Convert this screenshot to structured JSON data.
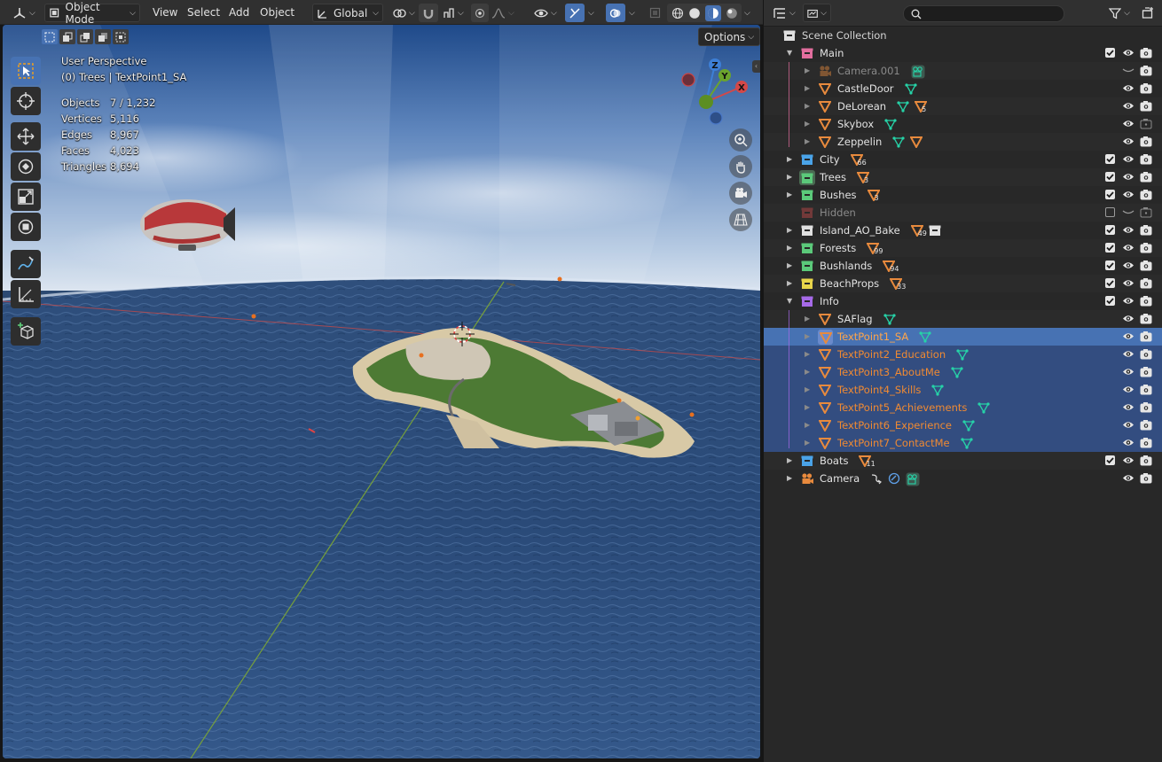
{
  "header": {
    "mode_label": "Object Mode",
    "menu_view": "View",
    "menu_select": "Select",
    "menu_add": "Add",
    "menu_object": "Object",
    "orientation_label": "Global",
    "options_label": "Options"
  },
  "overlay": {
    "view_name": "User Perspective",
    "context": "(0) Trees | TextPoint1_SA",
    "stats": [
      {
        "label": "Objects",
        "value": "7 / 1,232"
      },
      {
        "label": "Vertices",
        "value": "5,116"
      },
      {
        "label": "Edges",
        "value": "8,967"
      },
      {
        "label": "Faces",
        "value": "4,023"
      },
      {
        "label": "Triangles",
        "value": "8,694"
      }
    ]
  },
  "gizmo": {
    "z": "Z",
    "y": "Y",
    "x": "X"
  },
  "colors": {
    "accent": "#4772b3",
    "selection_row": "#334d80",
    "object_orange": "#e88a3d",
    "data_teal": "#26d3a8",
    "collection_white": "#e0e0e0",
    "collection_pink": "#e26e9e",
    "collection_blue": "#4aa3e8",
    "collection_green": "#5bc97a",
    "collection_red": "#c84b4b",
    "collection_yellow": "#e8d44a",
    "collection_purple": "#a66ae8"
  },
  "outliner": {
    "root": "Scene Collection",
    "rows": [
      {
        "name": "Main",
        "icon": "collection-icon",
        "color": "#e26e9e",
        "level": 1,
        "expanded": true,
        "checkbox": true,
        "extras": []
      },
      {
        "name": "Camera.001",
        "icon": "camera-object-icon",
        "level": 2,
        "dim": true,
        "extras": [
          {
            "icon": "camera-data-icon"
          }
        ],
        "eye": "closed"
      },
      {
        "name": "CastleDoor",
        "icon": "mesh-object-icon",
        "level": 2,
        "extras": [
          {
            "icon": "mesh-data-icon"
          }
        ]
      },
      {
        "name": "DeLorean",
        "icon": "mesh-object-icon",
        "level": 2,
        "extras": [
          {
            "icon": "mesh-data-icon"
          },
          {
            "icon": "mesh-object-icon",
            "count": "5"
          }
        ]
      },
      {
        "name": "Skybox",
        "icon": "mesh-object-icon",
        "level": 2,
        "extras": [
          {
            "icon": "mesh-data-icon"
          }
        ],
        "render": "off"
      },
      {
        "name": "Zeppelin",
        "icon": "mesh-object-icon",
        "level": 2,
        "extras": [
          {
            "icon": "mesh-data-icon"
          },
          {
            "icon": "mesh-object-icon"
          }
        ]
      },
      {
        "name": "City",
        "icon": "collection-icon",
        "color": "#4aa3e8",
        "level": 1,
        "checkbox": true,
        "extras": [
          {
            "icon": "mesh-object-icon",
            "count": "66"
          }
        ]
      },
      {
        "name": "Trees",
        "icon": "collection-icon",
        "color": "#5bc97a",
        "level": 1,
        "checkbox": true,
        "active": true,
        "extras": [
          {
            "icon": "mesh-object-icon",
            "count": "3"
          }
        ]
      },
      {
        "name": "Bushes",
        "icon": "collection-icon",
        "color": "#5bc97a",
        "level": 1,
        "checkbox": true,
        "extras": [
          {
            "icon": "mesh-object-icon",
            "count": "3"
          }
        ]
      },
      {
        "name": "Hidden",
        "icon": "collection-icon",
        "color": "#c84b4b",
        "level": 1,
        "dim": true,
        "checkbox": false,
        "noexpand": true,
        "extras": [],
        "eye": "closed",
        "render": "off"
      },
      {
        "name": "Island_AO_Bake",
        "icon": "collection-icon",
        "color": "#e0e0e0",
        "level": 1,
        "checkbox": true,
        "extras": [
          {
            "icon": "mesh-object-icon",
            "count": "49"
          },
          {
            "icon": "collection-icon"
          }
        ]
      },
      {
        "name": "Forests",
        "icon": "collection-icon",
        "color": "#5bc97a",
        "level": 1,
        "checkbox": true,
        "extras": [
          {
            "icon": "mesh-object-icon",
            "count": "99"
          }
        ]
      },
      {
        "name": "Bushlands",
        "icon": "collection-icon",
        "color": "#5bc97a",
        "level": 1,
        "checkbox": true,
        "extras": [
          {
            "icon": "mesh-object-icon",
            "count": "94"
          }
        ]
      },
      {
        "name": "BeachProps",
        "icon": "collection-icon",
        "color": "#e8d44a",
        "level": 1,
        "checkbox": true,
        "extras": [
          {
            "icon": "mesh-object-icon",
            "count": "33"
          }
        ]
      },
      {
        "name": "Info",
        "icon": "collection-icon",
        "color": "#a66ae8",
        "level": 1,
        "expanded": true,
        "checkbox": true,
        "extras": []
      },
      {
        "name": "SAFlag",
        "icon": "mesh-object-icon",
        "level": 2,
        "extras": [
          {
            "icon": "mesh-data-icon"
          }
        ]
      },
      {
        "name": "TextPoint1_SA",
        "icon": "mesh-object-icon",
        "level": 2,
        "selected": true,
        "activeSel": true,
        "extras": [
          {
            "icon": "mesh-data-icon"
          }
        ]
      },
      {
        "name": "TextPoint2_Education",
        "icon": "mesh-object-icon",
        "level": 2,
        "selected": true,
        "extras": [
          {
            "icon": "mesh-data-icon"
          }
        ]
      },
      {
        "name": "TextPoint3_AboutMe",
        "icon": "mesh-object-icon",
        "level": 2,
        "selected": true,
        "extras": [
          {
            "icon": "mesh-data-icon"
          }
        ]
      },
      {
        "name": "TextPoint4_Skills",
        "icon": "mesh-object-icon",
        "level": 2,
        "selected": true,
        "extras": [
          {
            "icon": "mesh-data-icon"
          }
        ]
      },
      {
        "name": "TextPoint5_Achievements",
        "icon": "mesh-object-icon",
        "level": 2,
        "selected": true,
        "extras": [
          {
            "icon": "mesh-data-icon"
          }
        ]
      },
      {
        "name": "TextPoint6_Experience",
        "icon": "mesh-object-icon",
        "level": 2,
        "selected": true,
        "extras": [
          {
            "icon": "mesh-data-icon"
          }
        ]
      },
      {
        "name": "TextPoint7_ContactMe",
        "icon": "mesh-object-icon",
        "level": 2,
        "selected": true,
        "extras": [
          {
            "icon": "mesh-data-icon"
          }
        ]
      },
      {
        "name": "Boats",
        "icon": "collection-icon",
        "color": "#4aa3e8",
        "level": 1,
        "checkbox": true,
        "extras": [
          {
            "icon": "mesh-object-icon",
            "count": "11"
          }
        ]
      },
      {
        "name": "Camera",
        "icon": "camera-object-icon",
        "level": 1,
        "extras": [
          {
            "icon": "constraint-icon"
          },
          {
            "icon": "lens-icon"
          },
          {
            "icon": "camera-data-icon"
          }
        ]
      }
    ]
  }
}
